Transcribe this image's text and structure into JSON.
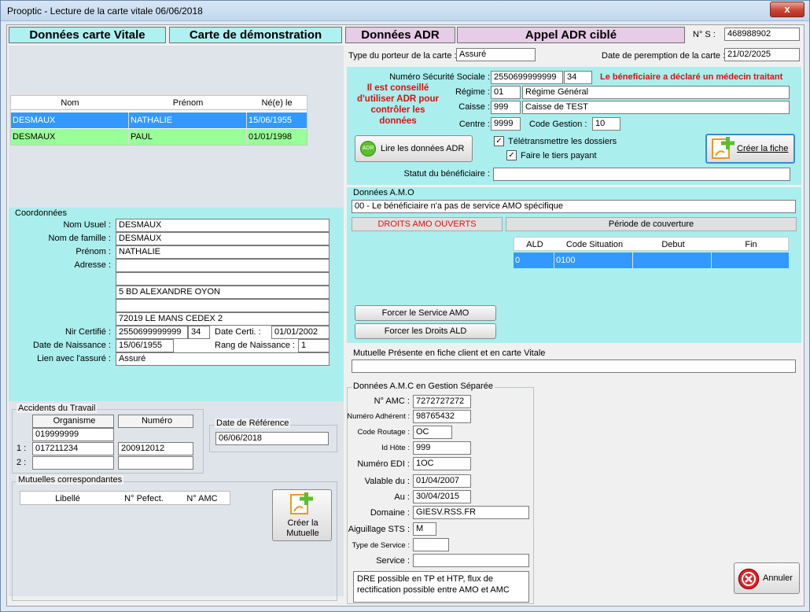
{
  "window": {
    "title": "Prooptic - Lecture de la carte vitale 06/06/2018",
    "close_glyph": "x"
  },
  "headers": {
    "donnees_carte_vitale": "Données carte Vitale",
    "carte_demo": "Carte de démonstration",
    "donnees_adr": "Données ADR",
    "appel_adr": "Appel ADR ciblé",
    "ns_label": "N° S :",
    "ns_value": "468988902"
  },
  "porteur": {
    "label": "Type du porteur de la carte :",
    "value": "Assuré"
  },
  "peremption": {
    "label": "Date de peremption de la carte :",
    "value": "21/02/2025"
  },
  "beneficiaries": {
    "columns": [
      "Nom",
      "Prénom",
      "Né(e) le"
    ],
    "rows": [
      {
        "nom": "DESMAUX",
        "prenom": "NATHALIE",
        "ne": "15/06/1955"
      },
      {
        "nom": "DESMAUX",
        "prenom": "PAUL",
        "ne": "01/01/1998"
      }
    ]
  },
  "secu": {
    "label": "Numéro Sécurité Sociale :",
    "num": "2550699999999",
    "cle": "34",
    "warning": "Le béneficiaire a déclaré un médecin traitant",
    "advice": "Il est conseillé d'utiliser ADR pour contrôler les données",
    "regime_label": "Régime :",
    "regime_code": "01",
    "regime_name": "Régime Général",
    "caisse_label": "Caisse :",
    "caisse_code": "999",
    "caisse_name": "Caisse de TEST",
    "centre_label": "Centre :",
    "centre_code": "9999",
    "code_gestion_label": "Code Gestion :",
    "code_gestion": "10",
    "teletransmettre": "Télétransmettre les dossiers",
    "tiers_payant": "Faire le tiers payant",
    "lire_adr": "Lire les données ADR",
    "creer_fiche": "Créer la fiche",
    "statut_label": "Statut du bénéficiaire :",
    "statut_value": ""
  },
  "coordonnees": {
    "title": "Coordonnées",
    "nom_usuel_label": "Nom Usuel :",
    "nom_usuel": "DESMAUX",
    "nom_famille_label": "Nom de famille :",
    "nom_famille": "DESMAUX",
    "prenom_label": "Prénom :",
    "prenom": "NATHALIE",
    "adresse_label": "Adresse :",
    "adresse": [
      "",
      "",
      "5 BD ALEXANDRE OYON",
      "",
      "72019 LE MANS CEDEX 2"
    ],
    "nir_label": "Nir Certifié :",
    "nir": "2550699999999",
    "nir_cle": "34",
    "date_certi_label": "Date Certi. :",
    "date_certi": "01/01/2002",
    "naissance_label": "Date de Naissance :",
    "naissance": "15/06/1955",
    "rang_label": "Rang de Naissance :",
    "rang": "1",
    "lien_label": "Lien avec l'assuré :",
    "lien": "Assuré"
  },
  "amo": {
    "title": "Données A.M.O",
    "service": "00 - Le bénéficiaire n'a pas de service AMO spécifique",
    "droits": "DROITS AMO OUVERTS",
    "periode": "Période de couverture",
    "columns": [
      "ALD",
      "Code Situation",
      "Debut",
      "Fin"
    ],
    "row": {
      "ald": "0",
      "code": "0100",
      "debut": "",
      "fin": ""
    },
    "forcer_service": "Forcer le Service AMO",
    "forcer_droits": "Forcer les Droits ALD"
  },
  "mutuelle_presente": {
    "label": "Mutuelle Présente en fiche client et en carte Vitale",
    "value": ""
  },
  "accidents": {
    "title": "Accidents du Travail",
    "organisme_h": "Organisme",
    "numero_h": "Numéro",
    "org0": "019999999",
    "row1_idx": "1 :",
    "org1": "017211234",
    "num1": "200912012",
    "row2_idx": "2 :",
    "org2": "",
    "num2": ""
  },
  "date_ref": {
    "title": "Date de Référence",
    "value": "06/06/2018"
  },
  "mutuelles": {
    "title": "Mutuelles correspondantes",
    "columns": [
      "Libellé",
      "N° Pefect.",
      "N° AMC"
    ],
    "creer_label": "Créer la Mutuelle"
  },
  "amc": {
    "title": "Données A.M.C en Gestion Séparée",
    "n_amc_label": "N° AMC :",
    "n_amc": "7272727272",
    "adherent_label": "Numéro Adhérent :",
    "adherent": "98765432",
    "routage_label": "Code Routage :",
    "routage": "OC",
    "hote_label": "Id Hôte :",
    "hote": "999",
    "edi_label": "Numéro EDI :",
    "edi": "1OC",
    "valable_label": "Valable du :",
    "valable": "01/04/2007",
    "au_label": "Au :",
    "au": "30/04/2015",
    "domaine_label": "Domaine :",
    "domaine": "GIESV.RSS.FR",
    "aiguillage_label": "Aiguillage STS :",
    "aiguillage": "M",
    "type_service_label": "Type de Service :",
    "type_service": "",
    "service_label": "Service :",
    "service": "",
    "note": "DRE possible en TP et HTP, flux de rectification possible entre AMO et AMC"
  },
  "annuler": "Annuler",
  "colors": {
    "selected_row": "#3399ff",
    "green_row": "#99ff99",
    "panel": "#aaeeee",
    "warn": "#e01010"
  }
}
